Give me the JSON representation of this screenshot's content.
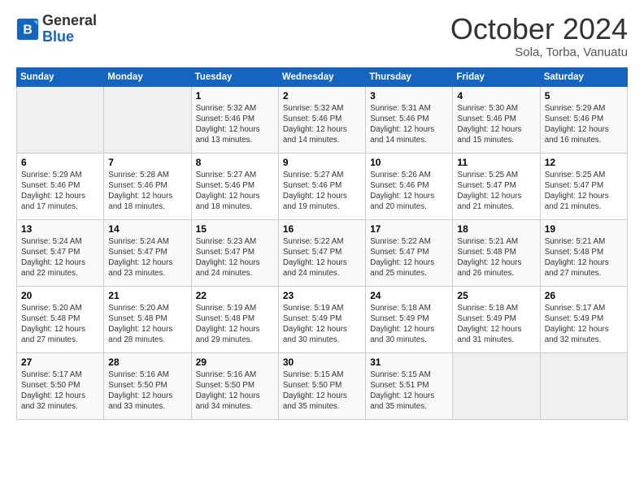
{
  "header": {
    "logo_general": "General",
    "logo_blue": "Blue",
    "month_title": "October 2024",
    "location": "Sola, Torba, Vanuatu"
  },
  "days_of_week": [
    "Sunday",
    "Monday",
    "Tuesday",
    "Wednesday",
    "Thursday",
    "Friday",
    "Saturday"
  ],
  "weeks": [
    [
      {
        "day": "",
        "sunrise": "",
        "sunset": "",
        "daylight": ""
      },
      {
        "day": "",
        "sunrise": "",
        "sunset": "",
        "daylight": ""
      },
      {
        "day": "1",
        "sunrise": "Sunrise: 5:32 AM",
        "sunset": "Sunset: 5:46 PM",
        "daylight": "Daylight: 12 hours and 13 minutes."
      },
      {
        "day": "2",
        "sunrise": "Sunrise: 5:32 AM",
        "sunset": "Sunset: 5:46 PM",
        "daylight": "Daylight: 12 hours and 14 minutes."
      },
      {
        "day": "3",
        "sunrise": "Sunrise: 5:31 AM",
        "sunset": "Sunset: 5:46 PM",
        "daylight": "Daylight: 12 hours and 14 minutes."
      },
      {
        "day": "4",
        "sunrise": "Sunrise: 5:30 AM",
        "sunset": "Sunset: 5:46 PM",
        "daylight": "Daylight: 12 hours and 15 minutes."
      },
      {
        "day": "5",
        "sunrise": "Sunrise: 5:29 AM",
        "sunset": "Sunset: 5:46 PM",
        "daylight": "Daylight: 12 hours and 16 minutes."
      }
    ],
    [
      {
        "day": "6",
        "sunrise": "Sunrise: 5:29 AM",
        "sunset": "Sunset: 5:46 PM",
        "daylight": "Daylight: 12 hours and 17 minutes."
      },
      {
        "day": "7",
        "sunrise": "Sunrise: 5:28 AM",
        "sunset": "Sunset: 5:46 PM",
        "daylight": "Daylight: 12 hours and 18 minutes."
      },
      {
        "day": "8",
        "sunrise": "Sunrise: 5:27 AM",
        "sunset": "Sunset: 5:46 PM",
        "daylight": "Daylight: 12 hours and 18 minutes."
      },
      {
        "day": "9",
        "sunrise": "Sunrise: 5:27 AM",
        "sunset": "Sunset: 5:46 PM",
        "daylight": "Daylight: 12 hours and 19 minutes."
      },
      {
        "day": "10",
        "sunrise": "Sunrise: 5:26 AM",
        "sunset": "Sunset: 5:46 PM",
        "daylight": "Daylight: 12 hours and 20 minutes."
      },
      {
        "day": "11",
        "sunrise": "Sunrise: 5:25 AM",
        "sunset": "Sunset: 5:47 PM",
        "daylight": "Daylight: 12 hours and 21 minutes."
      },
      {
        "day": "12",
        "sunrise": "Sunrise: 5:25 AM",
        "sunset": "Sunset: 5:47 PM",
        "daylight": "Daylight: 12 hours and 21 minutes."
      }
    ],
    [
      {
        "day": "13",
        "sunrise": "Sunrise: 5:24 AM",
        "sunset": "Sunset: 5:47 PM",
        "daylight": "Daylight: 12 hours and 22 minutes."
      },
      {
        "day": "14",
        "sunrise": "Sunrise: 5:24 AM",
        "sunset": "Sunset: 5:47 PM",
        "daylight": "Daylight: 12 hours and 23 minutes."
      },
      {
        "day": "15",
        "sunrise": "Sunrise: 5:23 AM",
        "sunset": "Sunset: 5:47 PM",
        "daylight": "Daylight: 12 hours and 24 minutes."
      },
      {
        "day": "16",
        "sunrise": "Sunrise: 5:22 AM",
        "sunset": "Sunset: 5:47 PM",
        "daylight": "Daylight: 12 hours and 24 minutes."
      },
      {
        "day": "17",
        "sunrise": "Sunrise: 5:22 AM",
        "sunset": "Sunset: 5:47 PM",
        "daylight": "Daylight: 12 hours and 25 minutes."
      },
      {
        "day": "18",
        "sunrise": "Sunrise: 5:21 AM",
        "sunset": "Sunset: 5:48 PM",
        "daylight": "Daylight: 12 hours and 26 minutes."
      },
      {
        "day": "19",
        "sunrise": "Sunrise: 5:21 AM",
        "sunset": "Sunset: 5:48 PM",
        "daylight": "Daylight: 12 hours and 27 minutes."
      }
    ],
    [
      {
        "day": "20",
        "sunrise": "Sunrise: 5:20 AM",
        "sunset": "Sunset: 5:48 PM",
        "daylight": "Daylight: 12 hours and 27 minutes."
      },
      {
        "day": "21",
        "sunrise": "Sunrise: 5:20 AM",
        "sunset": "Sunset: 5:48 PM",
        "daylight": "Daylight: 12 hours and 28 minutes."
      },
      {
        "day": "22",
        "sunrise": "Sunrise: 5:19 AM",
        "sunset": "Sunset: 5:48 PM",
        "daylight": "Daylight: 12 hours and 29 minutes."
      },
      {
        "day": "23",
        "sunrise": "Sunrise: 5:19 AM",
        "sunset": "Sunset: 5:49 PM",
        "daylight": "Daylight: 12 hours and 30 minutes."
      },
      {
        "day": "24",
        "sunrise": "Sunrise: 5:18 AM",
        "sunset": "Sunset: 5:49 PM",
        "daylight": "Daylight: 12 hours and 30 minutes."
      },
      {
        "day": "25",
        "sunrise": "Sunrise: 5:18 AM",
        "sunset": "Sunset: 5:49 PM",
        "daylight": "Daylight: 12 hours and 31 minutes."
      },
      {
        "day": "26",
        "sunrise": "Sunrise: 5:17 AM",
        "sunset": "Sunset: 5:49 PM",
        "daylight": "Daylight: 12 hours and 32 minutes."
      }
    ],
    [
      {
        "day": "27",
        "sunrise": "Sunrise: 5:17 AM",
        "sunset": "Sunset: 5:50 PM",
        "daylight": "Daylight: 12 hours and 32 minutes."
      },
      {
        "day": "28",
        "sunrise": "Sunrise: 5:16 AM",
        "sunset": "Sunset: 5:50 PM",
        "daylight": "Daylight: 12 hours and 33 minutes."
      },
      {
        "day": "29",
        "sunrise": "Sunrise: 5:16 AM",
        "sunset": "Sunset: 5:50 PM",
        "daylight": "Daylight: 12 hours and 34 minutes."
      },
      {
        "day": "30",
        "sunrise": "Sunrise: 5:15 AM",
        "sunset": "Sunset: 5:50 PM",
        "daylight": "Daylight: 12 hours and 35 minutes."
      },
      {
        "day": "31",
        "sunrise": "Sunrise: 5:15 AM",
        "sunset": "Sunset: 5:51 PM",
        "daylight": "Daylight: 12 hours and 35 minutes."
      },
      {
        "day": "",
        "sunrise": "",
        "sunset": "",
        "daylight": ""
      },
      {
        "day": "",
        "sunrise": "",
        "sunset": "",
        "daylight": ""
      }
    ]
  ]
}
